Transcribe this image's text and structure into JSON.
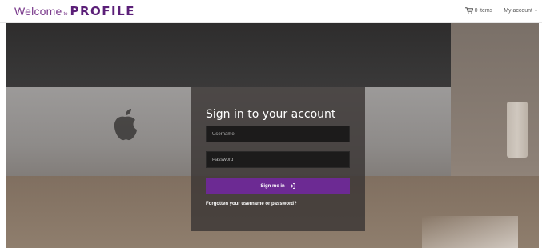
{
  "header": {
    "brand_welcome": "Welcome",
    "brand_to": "to",
    "brand_name": "PROFILE",
    "cart_label": "0 items",
    "account_label": "My account",
    "icons": [
      "cart-icon",
      "chevron-down-icon"
    ]
  },
  "signin": {
    "title": "Sign in to your account",
    "username_placeholder": "Username",
    "username_value": "",
    "password_placeholder": "Password",
    "password_value": "",
    "button_label": "Sign me in",
    "button_icon": "sign-in-icon",
    "forgot_link": "Forgotten your username or password?"
  },
  "colors": {
    "brand_purple": "#5b1f78",
    "button_purple": "#6c2a93",
    "panel_background": "#3a3634"
  }
}
